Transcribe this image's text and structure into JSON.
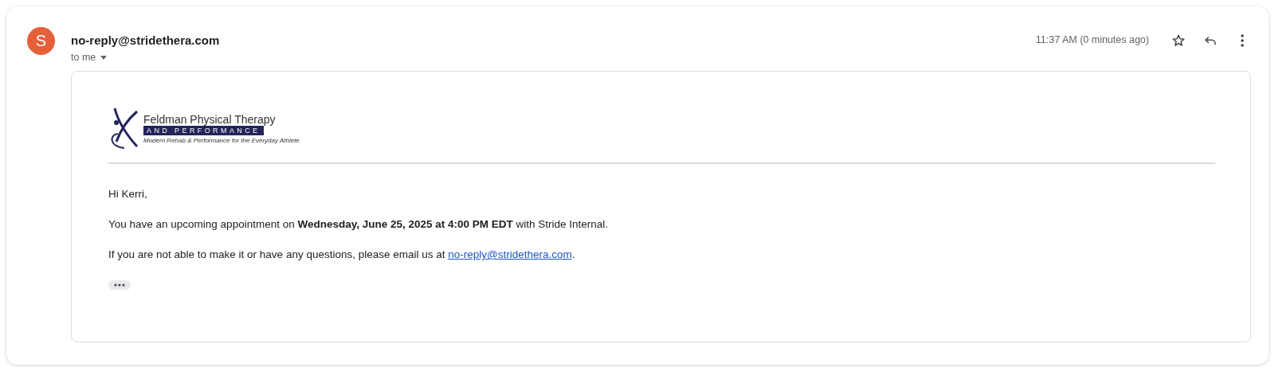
{
  "sender": {
    "avatar_letter": "S",
    "email": "no-reply@stridethera.com",
    "recipient": "to me"
  },
  "header": {
    "time": "11:37 AM (0 minutes ago)"
  },
  "logo": {
    "name": "Feldman Physical Therapy",
    "banner": "AND PERFORMANCE",
    "tagline": "Modern Rehab & Performance for the Everyday Athlete"
  },
  "body": {
    "greeting": "Hi Kerri,",
    "appointment": "You have an upcoming appointment on **Wednesday, June 25, 2025 at 4:00 PM EDT** with Stride Internal.",
    "contact": {
      "text_before": "If you are not able to make it or have any questions, please email us at ",
      "link": "no-reply@stridethera.com",
      "text_after": "."
    }
  }
}
